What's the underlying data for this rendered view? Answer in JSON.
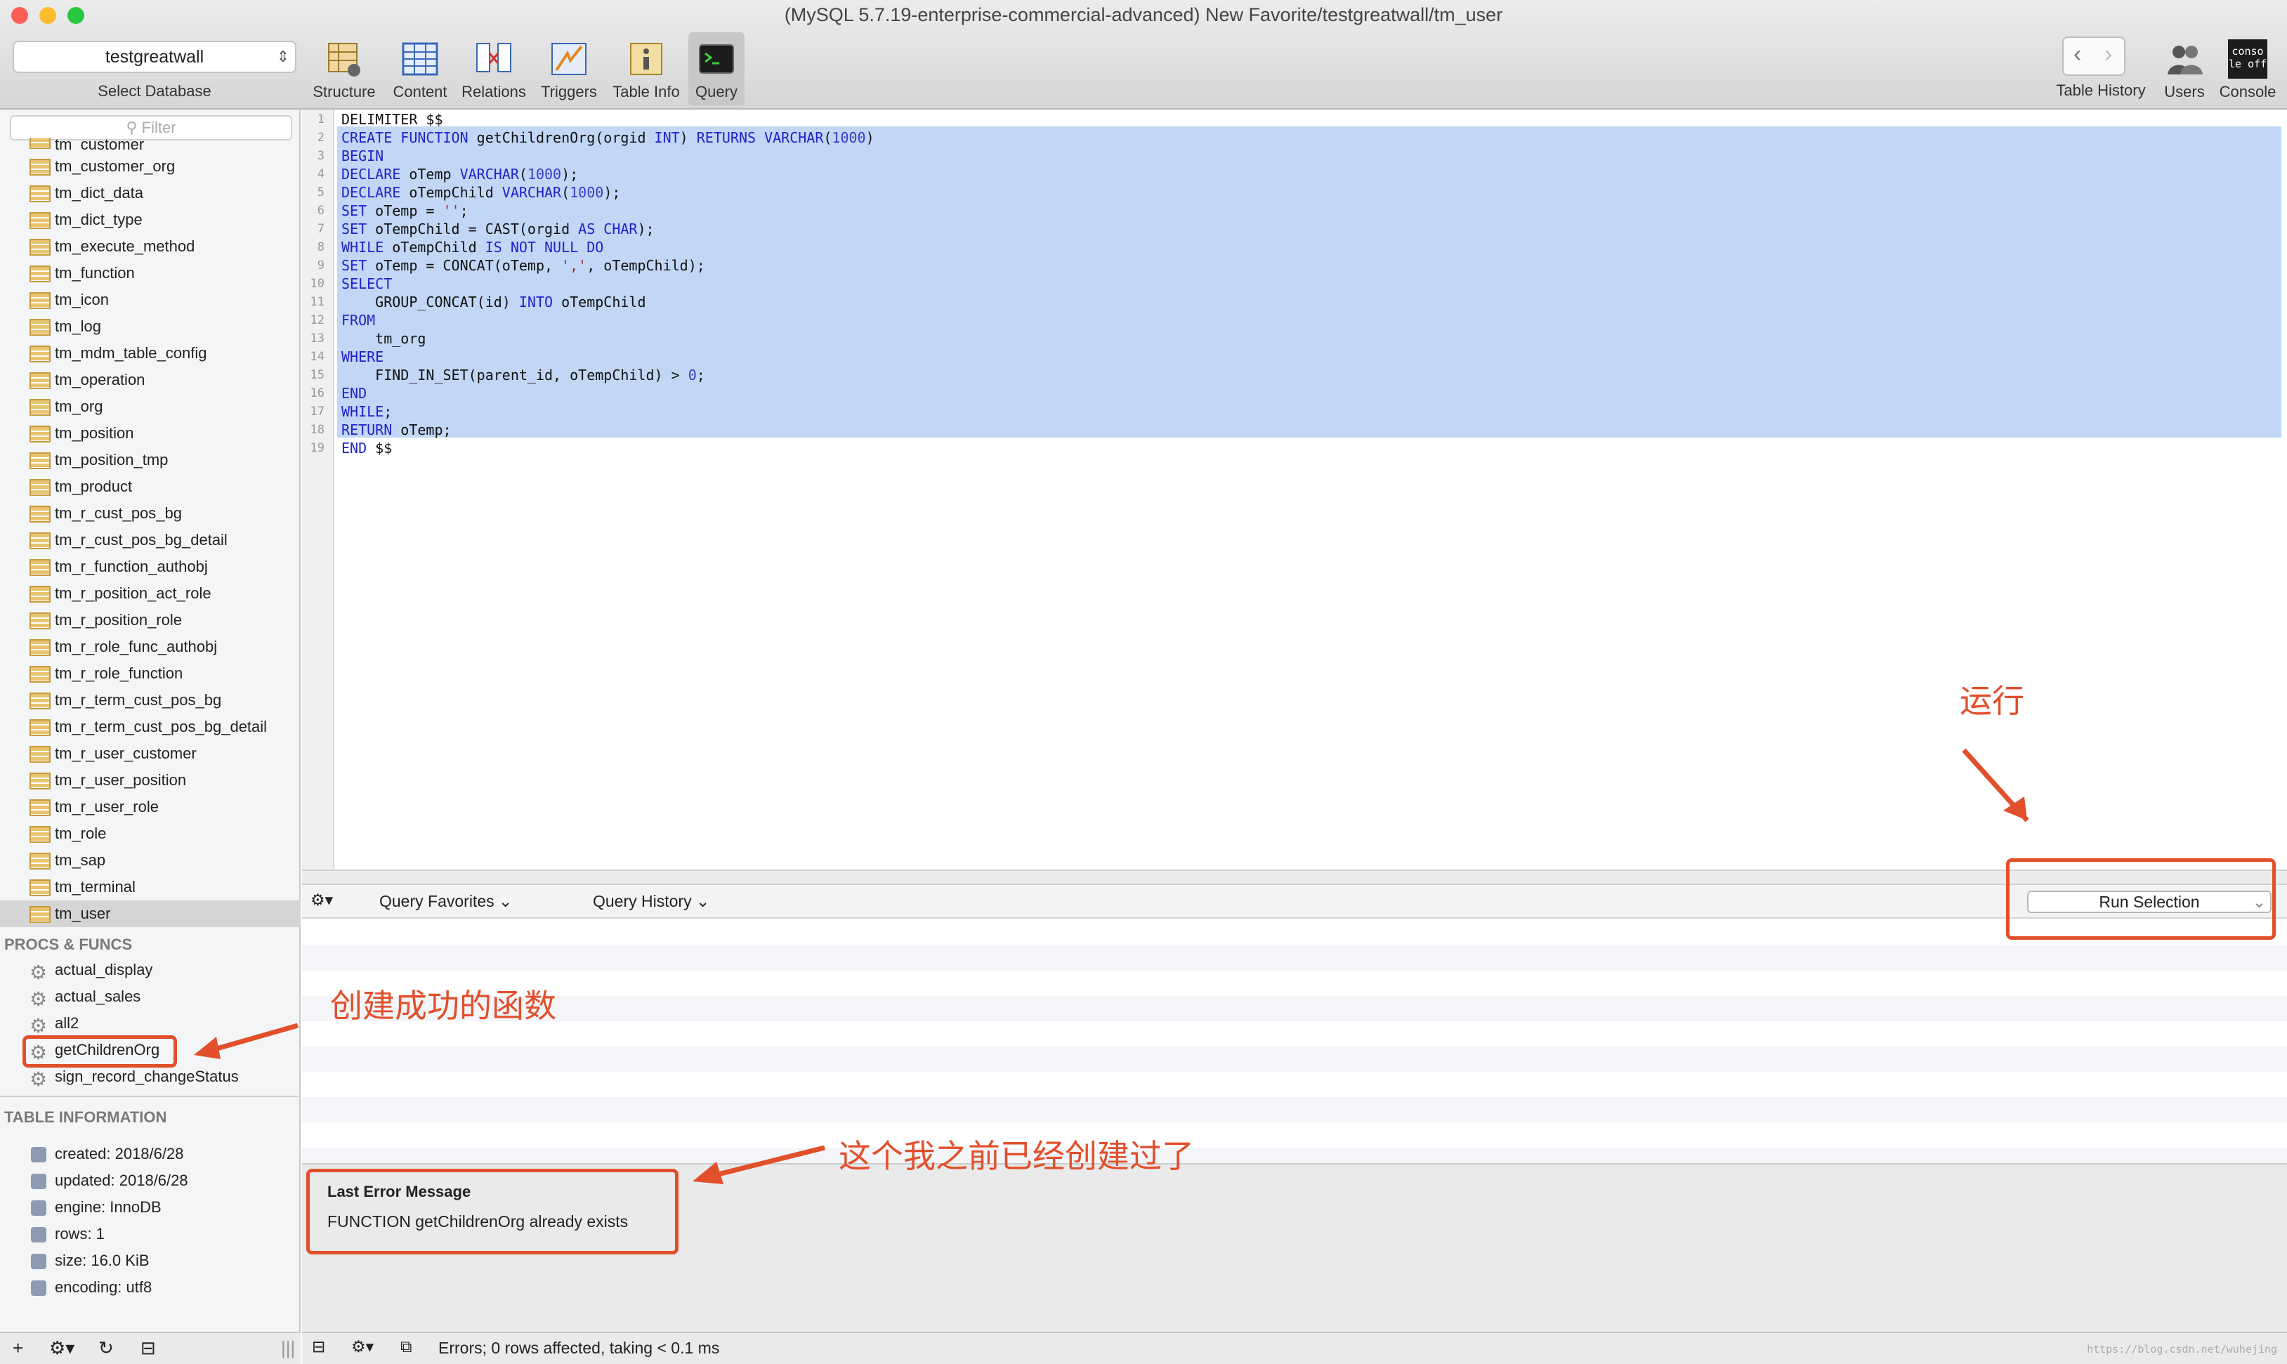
{
  "window": {
    "title": "(MySQL 5.7.19-enterprise-commercial-advanced) New Favorite/testgreatwall/tm_user"
  },
  "database_selector": {
    "value": "testgreatwall",
    "caption": "Select Database"
  },
  "toolbar": {
    "structure": "Structure",
    "content": "Content",
    "relations": "Relations",
    "triggers": "Triggers",
    "table_info": "Table Info",
    "query": "Query",
    "table_history": "Table History",
    "users": "Users",
    "console": "Console",
    "console_icon_text": "conso le off"
  },
  "sidebar": {
    "filter_placeholder": "Filter",
    "partial_item": "tm_customer",
    "tables": [
      "tm_customer_org",
      "tm_dict_data",
      "tm_dict_type",
      "tm_execute_method",
      "tm_function",
      "tm_icon",
      "tm_log",
      "tm_mdm_table_config",
      "tm_operation",
      "tm_org",
      "tm_position",
      "tm_position_tmp",
      "tm_product",
      "tm_r_cust_pos_bg",
      "tm_r_cust_pos_bg_detail",
      "tm_r_function_authobj",
      "tm_r_position_act_role",
      "tm_r_position_role",
      "tm_r_role_func_authobj",
      "tm_r_role_function",
      "tm_r_term_cust_pos_bg",
      "tm_r_term_cust_pos_bg_detail",
      "tm_r_user_customer",
      "tm_r_user_position",
      "tm_r_user_role",
      "tm_role",
      "tm_sap",
      "tm_terminal",
      "tm_user"
    ],
    "procs_header": "PROCS & FUNCS",
    "procs": [
      "actual_display",
      "actual_sales",
      "all2",
      "getChildrenOrg",
      "sign_record_changeStatus"
    ],
    "info_header": "TABLE INFORMATION",
    "info": [
      "created: 2018/6/28",
      "updated: 2018/6/28",
      "engine: InnoDB",
      "rows: 1",
      "size: 16.0 KiB",
      "encoding: utf8"
    ]
  },
  "editor": {
    "lines": [
      [
        [
          "DELIMITER $$",
          ""
        ]
      ],
      [
        [
          "CREATE FUNCTION",
          "kw"
        ],
        [
          " getChildrenOrg(orgid ",
          ""
        ],
        [
          "INT",
          "kw"
        ],
        [
          ") ",
          ""
        ],
        [
          "RETURNS VARCHAR",
          "kw"
        ],
        [
          "(",
          ""
        ],
        [
          "1000",
          "num"
        ],
        [
          ")",
          ""
        ]
      ],
      [
        [
          "BEGIN",
          "kw"
        ]
      ],
      [
        [
          "DECLARE",
          "kw"
        ],
        [
          " oTemp ",
          ""
        ],
        [
          "VARCHAR",
          "kw"
        ],
        [
          "(",
          ""
        ],
        [
          "1000",
          "num"
        ],
        [
          ");",
          ""
        ]
      ],
      [
        [
          "DECLARE",
          "kw"
        ],
        [
          " oTempChild ",
          ""
        ],
        [
          "VARCHAR",
          "kw"
        ],
        [
          "(",
          ""
        ],
        [
          "1000",
          "num"
        ],
        [
          ");",
          ""
        ]
      ],
      [
        [
          "SET",
          "kw"
        ],
        [
          " oTemp = ",
          ""
        ],
        [
          "''",
          "str"
        ],
        [
          ";",
          ""
        ]
      ],
      [
        [
          "SET",
          "kw"
        ],
        [
          " oTempChild = CAST(orgid ",
          ""
        ],
        [
          "AS CHAR",
          "kw"
        ],
        [
          ");",
          ""
        ]
      ],
      [
        [
          "WHILE",
          "kw"
        ],
        [
          " oTempChild ",
          ""
        ],
        [
          "IS NOT NULL DO",
          "kw"
        ]
      ],
      [
        [
          "SET",
          "kw"
        ],
        [
          " oTemp = CONCAT(oTemp, ",
          ""
        ],
        [
          "','",
          "str"
        ],
        [
          ", oTempChild);",
          ""
        ]
      ],
      [
        [
          "SELECT",
          "kw"
        ]
      ],
      [
        [
          "    GROUP_CONCAT(id) ",
          ""
        ],
        [
          "INTO",
          "kw"
        ],
        [
          " oTempChild",
          ""
        ]
      ],
      [
        [
          "FROM",
          "kw"
        ]
      ],
      [
        [
          "    tm_org",
          ""
        ]
      ],
      [
        [
          "WHERE",
          "kw"
        ]
      ],
      [
        [
          "    FIND_IN_SET(parent_id, oTempChild) > ",
          ""
        ],
        [
          "0",
          "num"
        ],
        [
          ";",
          ""
        ]
      ],
      [
        [
          "END",
          "kw"
        ]
      ],
      [
        [
          "WHILE",
          "kw"
        ],
        [
          ";",
          ""
        ]
      ],
      [
        [
          "RETURN",
          "kw"
        ],
        [
          " oTemp;",
          ""
        ]
      ],
      [
        [
          "END",
          "kw"
        ],
        [
          " $$",
          ""
        ]
      ]
    ]
  },
  "query_bar": {
    "favorites": "Query Favorites",
    "history": "Query History",
    "run": "Run Selection"
  },
  "error": {
    "title": "Last Error Message",
    "message": "FUNCTION getChildrenOrg already exists"
  },
  "status": {
    "text": "Errors; 0 rows affected, taking < 0.1 ms",
    "watermark": "https://blog.csdn.net/wuhejing"
  },
  "annotations": {
    "run": "运行",
    "created_func": "创建成功的函数",
    "already_created": "这个我之前已经创建过了"
  },
  "colors": {
    "accent_annotation": "#e24f2b",
    "selection": "#c2d6f5",
    "keyword": "#2222cc"
  }
}
